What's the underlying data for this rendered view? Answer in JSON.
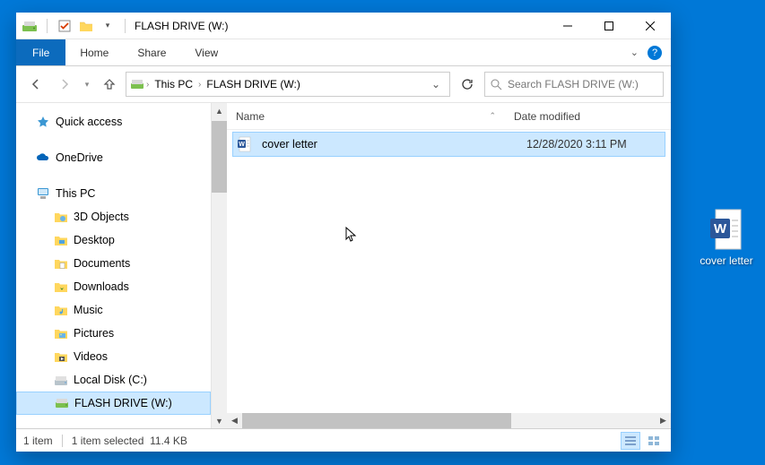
{
  "window": {
    "title": "FLASH DRIVE (W:)",
    "qat_dropdown": "▾"
  },
  "ribbon": {
    "file": "File",
    "tabs": [
      "Home",
      "Share",
      "View"
    ],
    "help": "?"
  },
  "nav": {
    "crumbs": [
      "This PC",
      "FLASH DRIVE (W:)"
    ],
    "search_placeholder": "Search FLASH DRIVE (W:)"
  },
  "sidebar": {
    "quick_access": "Quick access",
    "onedrive": "OneDrive",
    "this_pc": "This PC",
    "children": [
      {
        "label": "3D Objects"
      },
      {
        "label": "Desktop"
      },
      {
        "label": "Documents"
      },
      {
        "label": "Downloads"
      },
      {
        "label": "Music"
      },
      {
        "label": "Pictures"
      },
      {
        "label": "Videos"
      },
      {
        "label": "Local Disk (C:)"
      },
      {
        "label": "FLASH DRIVE (W:)"
      }
    ]
  },
  "columns": {
    "name": "Name",
    "date": "Date modified"
  },
  "files": [
    {
      "name": "cover letter",
      "date": "12/28/2020 3:11 PM",
      "type": "word"
    }
  ],
  "status": {
    "count": "1 item",
    "selected": "1 item selected",
    "size": "11.4 KB"
  },
  "desktop": {
    "item": "cover letter"
  }
}
